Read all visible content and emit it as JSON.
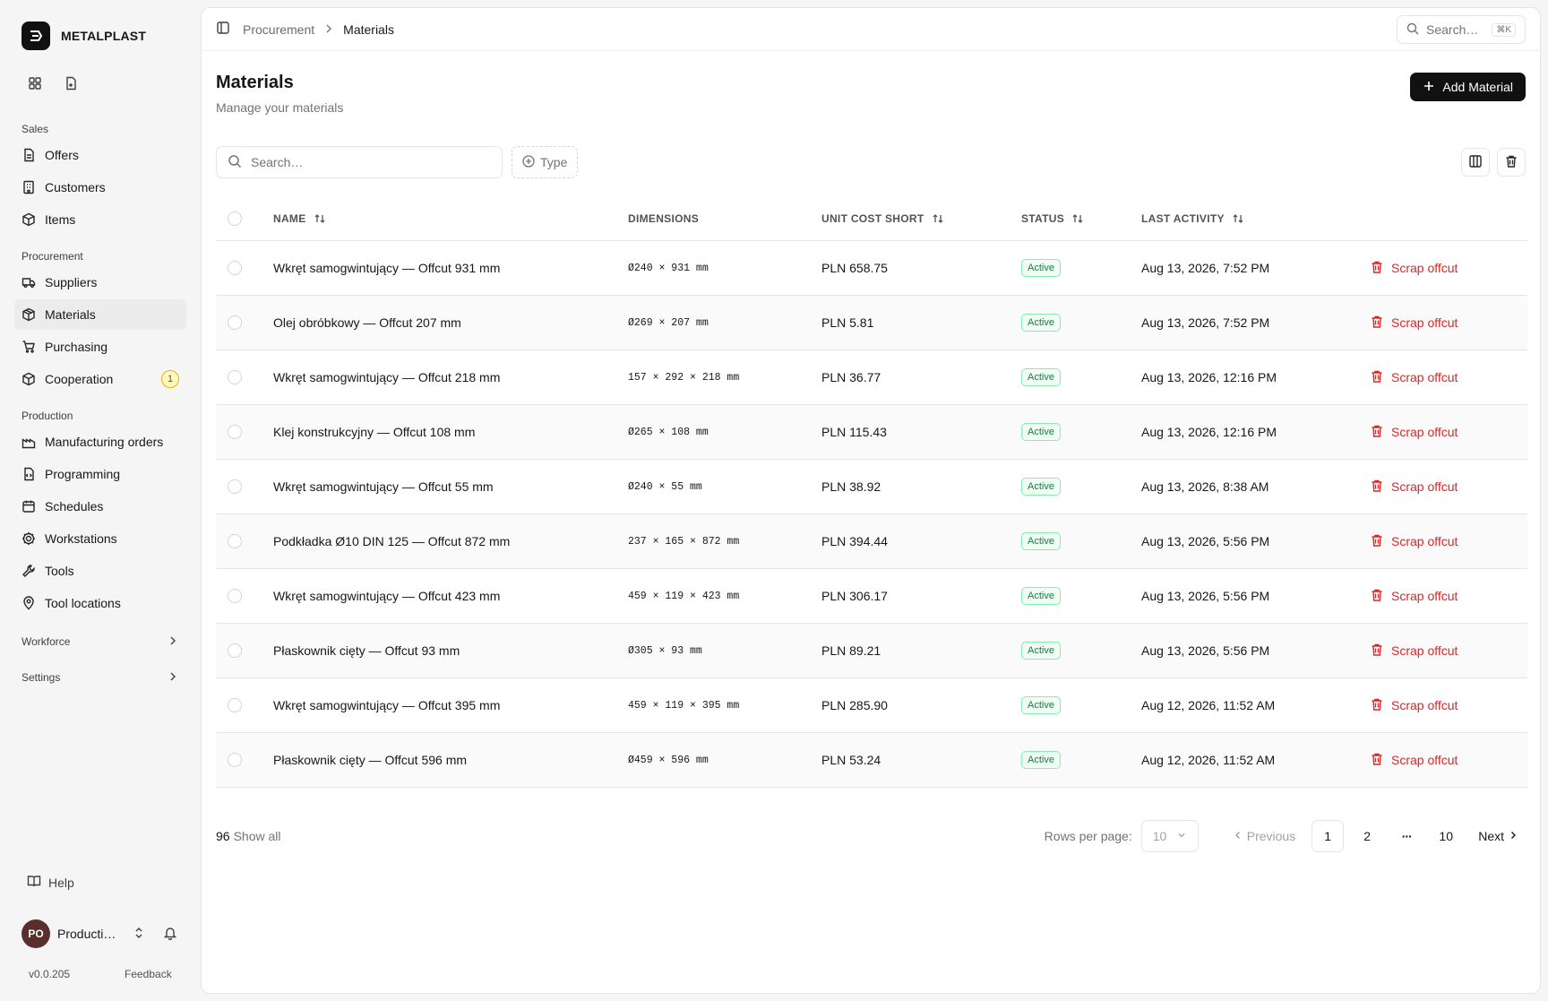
{
  "brand": {
    "name": "METALPLAST"
  },
  "sidebar": {
    "sections": [
      {
        "title": "Sales",
        "items": [
          {
            "label": "Offers",
            "icon": "file-text-icon"
          },
          {
            "label": "Customers",
            "icon": "building-icon"
          },
          {
            "label": "Items",
            "icon": "box-icon"
          }
        ]
      },
      {
        "title": "Procurement",
        "items": [
          {
            "label": "Suppliers",
            "icon": "truck-icon"
          },
          {
            "label": "Materials",
            "icon": "package-icon",
            "active": true
          },
          {
            "label": "Purchasing",
            "icon": "cart-icon"
          },
          {
            "label": "Cooperation",
            "icon": "cube-icon",
            "badge": "1"
          }
        ]
      },
      {
        "title": "Production",
        "items": [
          {
            "label": "Manufacturing orders",
            "icon": "factory-icon"
          },
          {
            "label": "Programming",
            "icon": "file-code-icon"
          },
          {
            "label": "Schedules",
            "icon": "calendar-icon"
          },
          {
            "label": "Workstations",
            "icon": "cog-icon"
          },
          {
            "label": "Tools",
            "icon": "wrench-icon"
          },
          {
            "label": "Tool locations",
            "icon": "map-pin-icon"
          }
        ]
      }
    ],
    "collapsed": [
      "Workforce",
      "Settings"
    ],
    "help": "Help",
    "user": {
      "initials": "PO",
      "name": "Production Operator"
    },
    "version": "v0.0.205",
    "feedback": "Feedback"
  },
  "topbar": {
    "breadcrumb": [
      "Procurement",
      "Materials"
    ],
    "search_placeholder": "Search…",
    "shortcut": "⌘K"
  },
  "page": {
    "title": "Materials",
    "subtitle": "Manage your materials",
    "add_button": "Add Material"
  },
  "filters": {
    "search_placeholder": "Search…",
    "type_label": "Type"
  },
  "table": {
    "columns": [
      "NAME",
      "DIMENSIONS",
      "UNIT COST SHORT",
      "STATUS",
      "LAST ACTIVITY"
    ],
    "action_label": "Scrap offcut",
    "rows": [
      {
        "name": "Wkręt samogwintujący — Offcut 931 mm",
        "dim": "Ø240 × 931 mm",
        "cost": "PLN 658.75",
        "status": "Active",
        "activity": "Aug 13, 2026, 7:52 PM"
      },
      {
        "name": "Olej obróbkowy — Offcut 207 mm",
        "dim": "Ø269 × 207 mm",
        "cost": "PLN 5.81",
        "status": "Active",
        "activity": "Aug 13, 2026, 7:52 PM"
      },
      {
        "name": "Wkręt samogwintujący — Offcut 218 mm",
        "dim": "157 × 292 × 218 mm",
        "cost": "PLN 36.77",
        "status": "Active",
        "activity": "Aug 13, 2026, 12:16 PM"
      },
      {
        "name": "Klej konstrukcyjny — Offcut 108 mm",
        "dim": "Ø265 × 108 mm",
        "cost": "PLN 115.43",
        "status": "Active",
        "activity": "Aug 13, 2026, 12:16 PM"
      },
      {
        "name": "Wkręt samogwintujący — Offcut 55 mm",
        "dim": "Ø240 × 55 mm",
        "cost": "PLN 38.92",
        "status": "Active",
        "activity": "Aug 13, 2026, 8:38 AM"
      },
      {
        "name": "Podkładka Ø10 DIN 125 — Offcut 872 mm",
        "dim": "237 × 165 × 872 mm",
        "cost": "PLN 394.44",
        "status": "Active",
        "activity": "Aug 13, 2026, 5:56 PM"
      },
      {
        "name": "Wkręt samogwintujący — Offcut 423 mm",
        "dim": "459 × 119 × 423 mm",
        "cost": "PLN 306.17",
        "status": "Active",
        "activity": "Aug 13, 2026, 5:56 PM"
      },
      {
        "name": "Płaskownik cięty — Offcut 93 mm",
        "dim": "Ø305 × 93 mm",
        "cost": "PLN 89.21",
        "status": "Active",
        "activity": "Aug 13, 2026, 5:56 PM"
      },
      {
        "name": "Wkręt samogwintujący — Offcut 395 mm",
        "dim": "459 × 119 × 395 mm",
        "cost": "PLN 285.90",
        "status": "Active",
        "activity": "Aug 12, 2026, 11:52 AM"
      },
      {
        "name": "Płaskownik cięty — Offcut 596 mm",
        "dim": "Ø459 × 596 mm",
        "cost": "PLN 53.24",
        "status": "Active",
        "activity": "Aug 12, 2026, 11:52 AM"
      }
    ]
  },
  "footer": {
    "total": "96",
    "show_all": "Show all",
    "rows_per_page_label": "Rows per page:",
    "rows_per_page": "10",
    "previous": "Previous",
    "pages": [
      "1",
      "2",
      "10"
    ],
    "current_page": "1",
    "ellipsis": "···",
    "next": "Next"
  },
  "colors": {
    "accent": "#111111",
    "danger": "#dc2626",
    "active_badge": "#15803d"
  }
}
